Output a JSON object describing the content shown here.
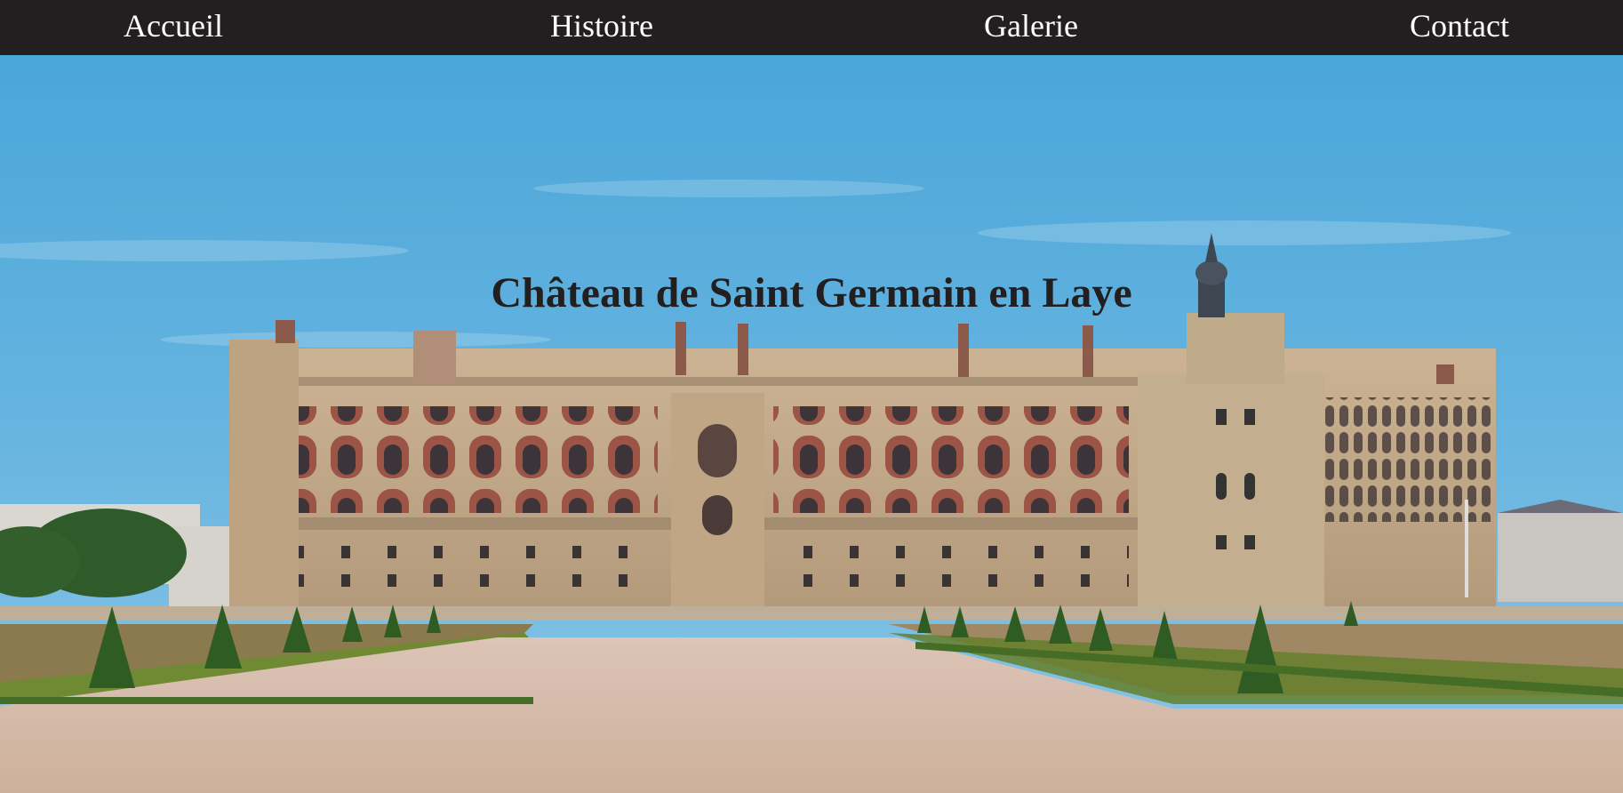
{
  "nav": {
    "items": [
      {
        "label": "Accueil"
      },
      {
        "label": "Histoire"
      },
      {
        "label": "Galerie"
      },
      {
        "label": "Contact"
      }
    ]
  },
  "hero": {
    "title": "Château de Saint Germain en Laye",
    "image_icon": "chateau-photo",
    "colors": {
      "navbar": "#231f20",
      "nav_text": "#ffffff",
      "title_text": "#231f20",
      "sky": "#5aaedb",
      "stone": "#c9b08e",
      "brick": "#a05a4a",
      "lawn": "#8a9a3a",
      "path": "#d8bfae"
    }
  }
}
